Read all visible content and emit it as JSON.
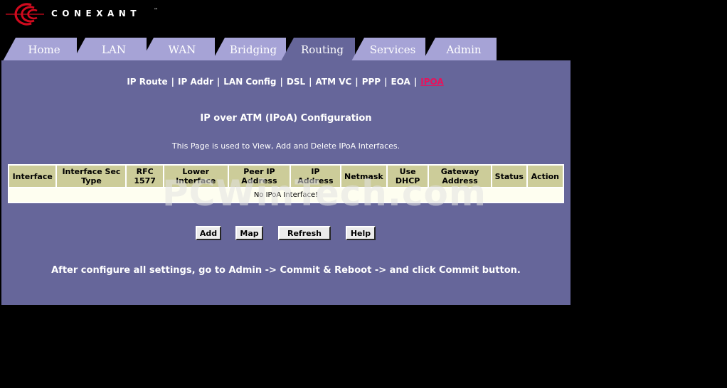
{
  "brand": {
    "name": "CONEXANT",
    "tm": "™",
    "color": "#d10a1e"
  },
  "tabs": [
    {
      "label": "Home"
    },
    {
      "label": "LAN"
    },
    {
      "label": "WAN"
    },
    {
      "label": "Bridging"
    },
    {
      "label": "Routing",
      "active": true
    },
    {
      "label": "Services"
    },
    {
      "label": "Admin"
    }
  ],
  "subnav": {
    "items": [
      {
        "label": "IP Route"
      },
      {
        "label": "IP Addr"
      },
      {
        "label": "LAN Config"
      },
      {
        "label": "DSL"
      },
      {
        "label": "ATM VC"
      },
      {
        "label": "PPP"
      },
      {
        "label": "EOA"
      },
      {
        "label": "IPOA",
        "current": true
      }
    ],
    "separator": "|"
  },
  "page": {
    "title": "IP over ATM (IPoA) Configuration",
    "description": "This Page is used to View, Add and Delete IPoA Interfaces."
  },
  "table": {
    "headers": [
      "Interface",
      "Interface Sec Type",
      "RFC 1577",
      "Lower Interface",
      "Peer IP Address",
      "IP Address",
      "Netmask",
      "Use DHCP",
      "Gateway Address",
      "Status",
      "Action"
    ],
    "empty_message": "No IPoA Interface!"
  },
  "buttons": {
    "add": "Add",
    "map": "Map",
    "refresh": "Refresh",
    "help": "Help"
  },
  "footer_note": "After configure all settings, go to Admin -> Commit & Reboot -> and click Commit button.",
  "watermark": "PCWinTech.com",
  "colors": {
    "background": "#000000",
    "panel": "#66669a",
    "tab": "#a6a3d6",
    "table_header": "#cccc99",
    "active_link": "#e8125c"
  }
}
